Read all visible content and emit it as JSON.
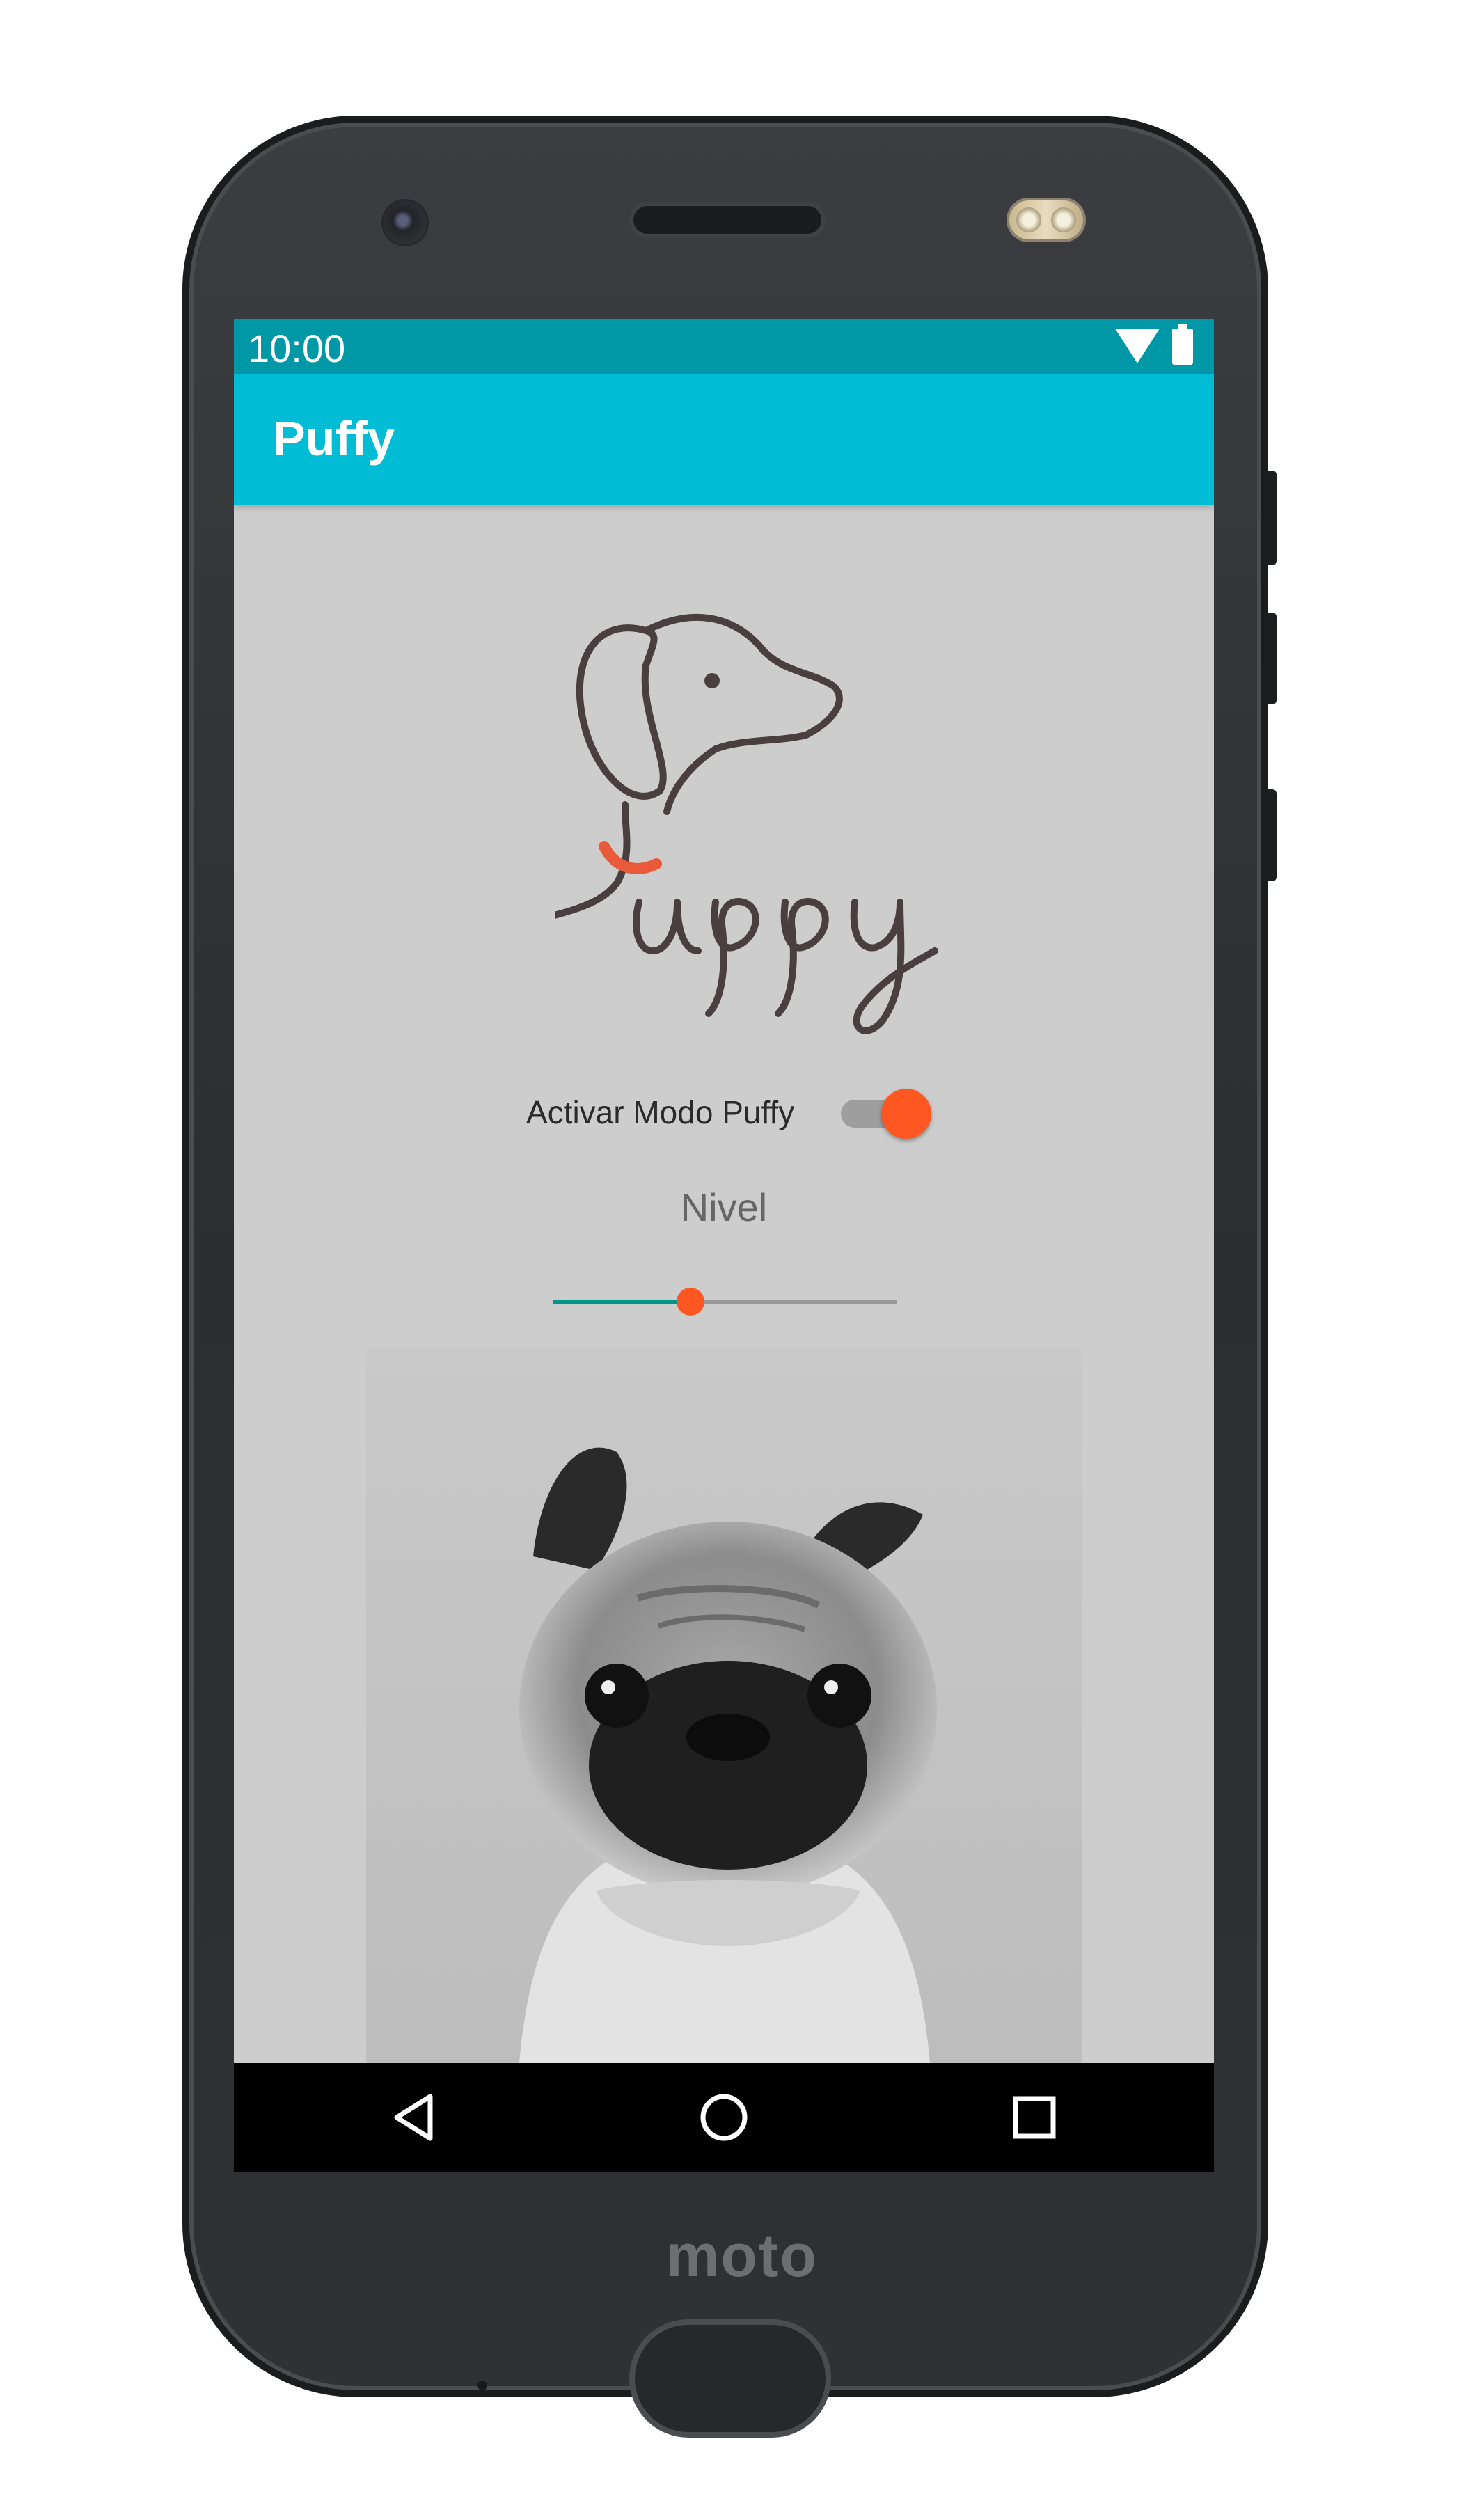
{
  "status_bar": {
    "time": "10:00"
  },
  "app_bar": {
    "title": "Puffy"
  },
  "settings": {
    "toggle_label": "Activar Modo Puffy",
    "toggle_on": true,
    "level_label": "Nivel",
    "level_fraction": 0.4
  },
  "device": {
    "brand": "moto"
  },
  "colors": {
    "status_bar": "#0097a7",
    "app_bar": "#00bcd4",
    "accent": "#ff5722",
    "slider_fill": "#009688",
    "screen_background": "#cdcdcd"
  },
  "icons": {
    "wifi": "wifi-icon",
    "battery": "battery-icon",
    "back": "back-triangle-icon",
    "home": "home-circle-icon",
    "recents": "recents-square-icon"
  }
}
